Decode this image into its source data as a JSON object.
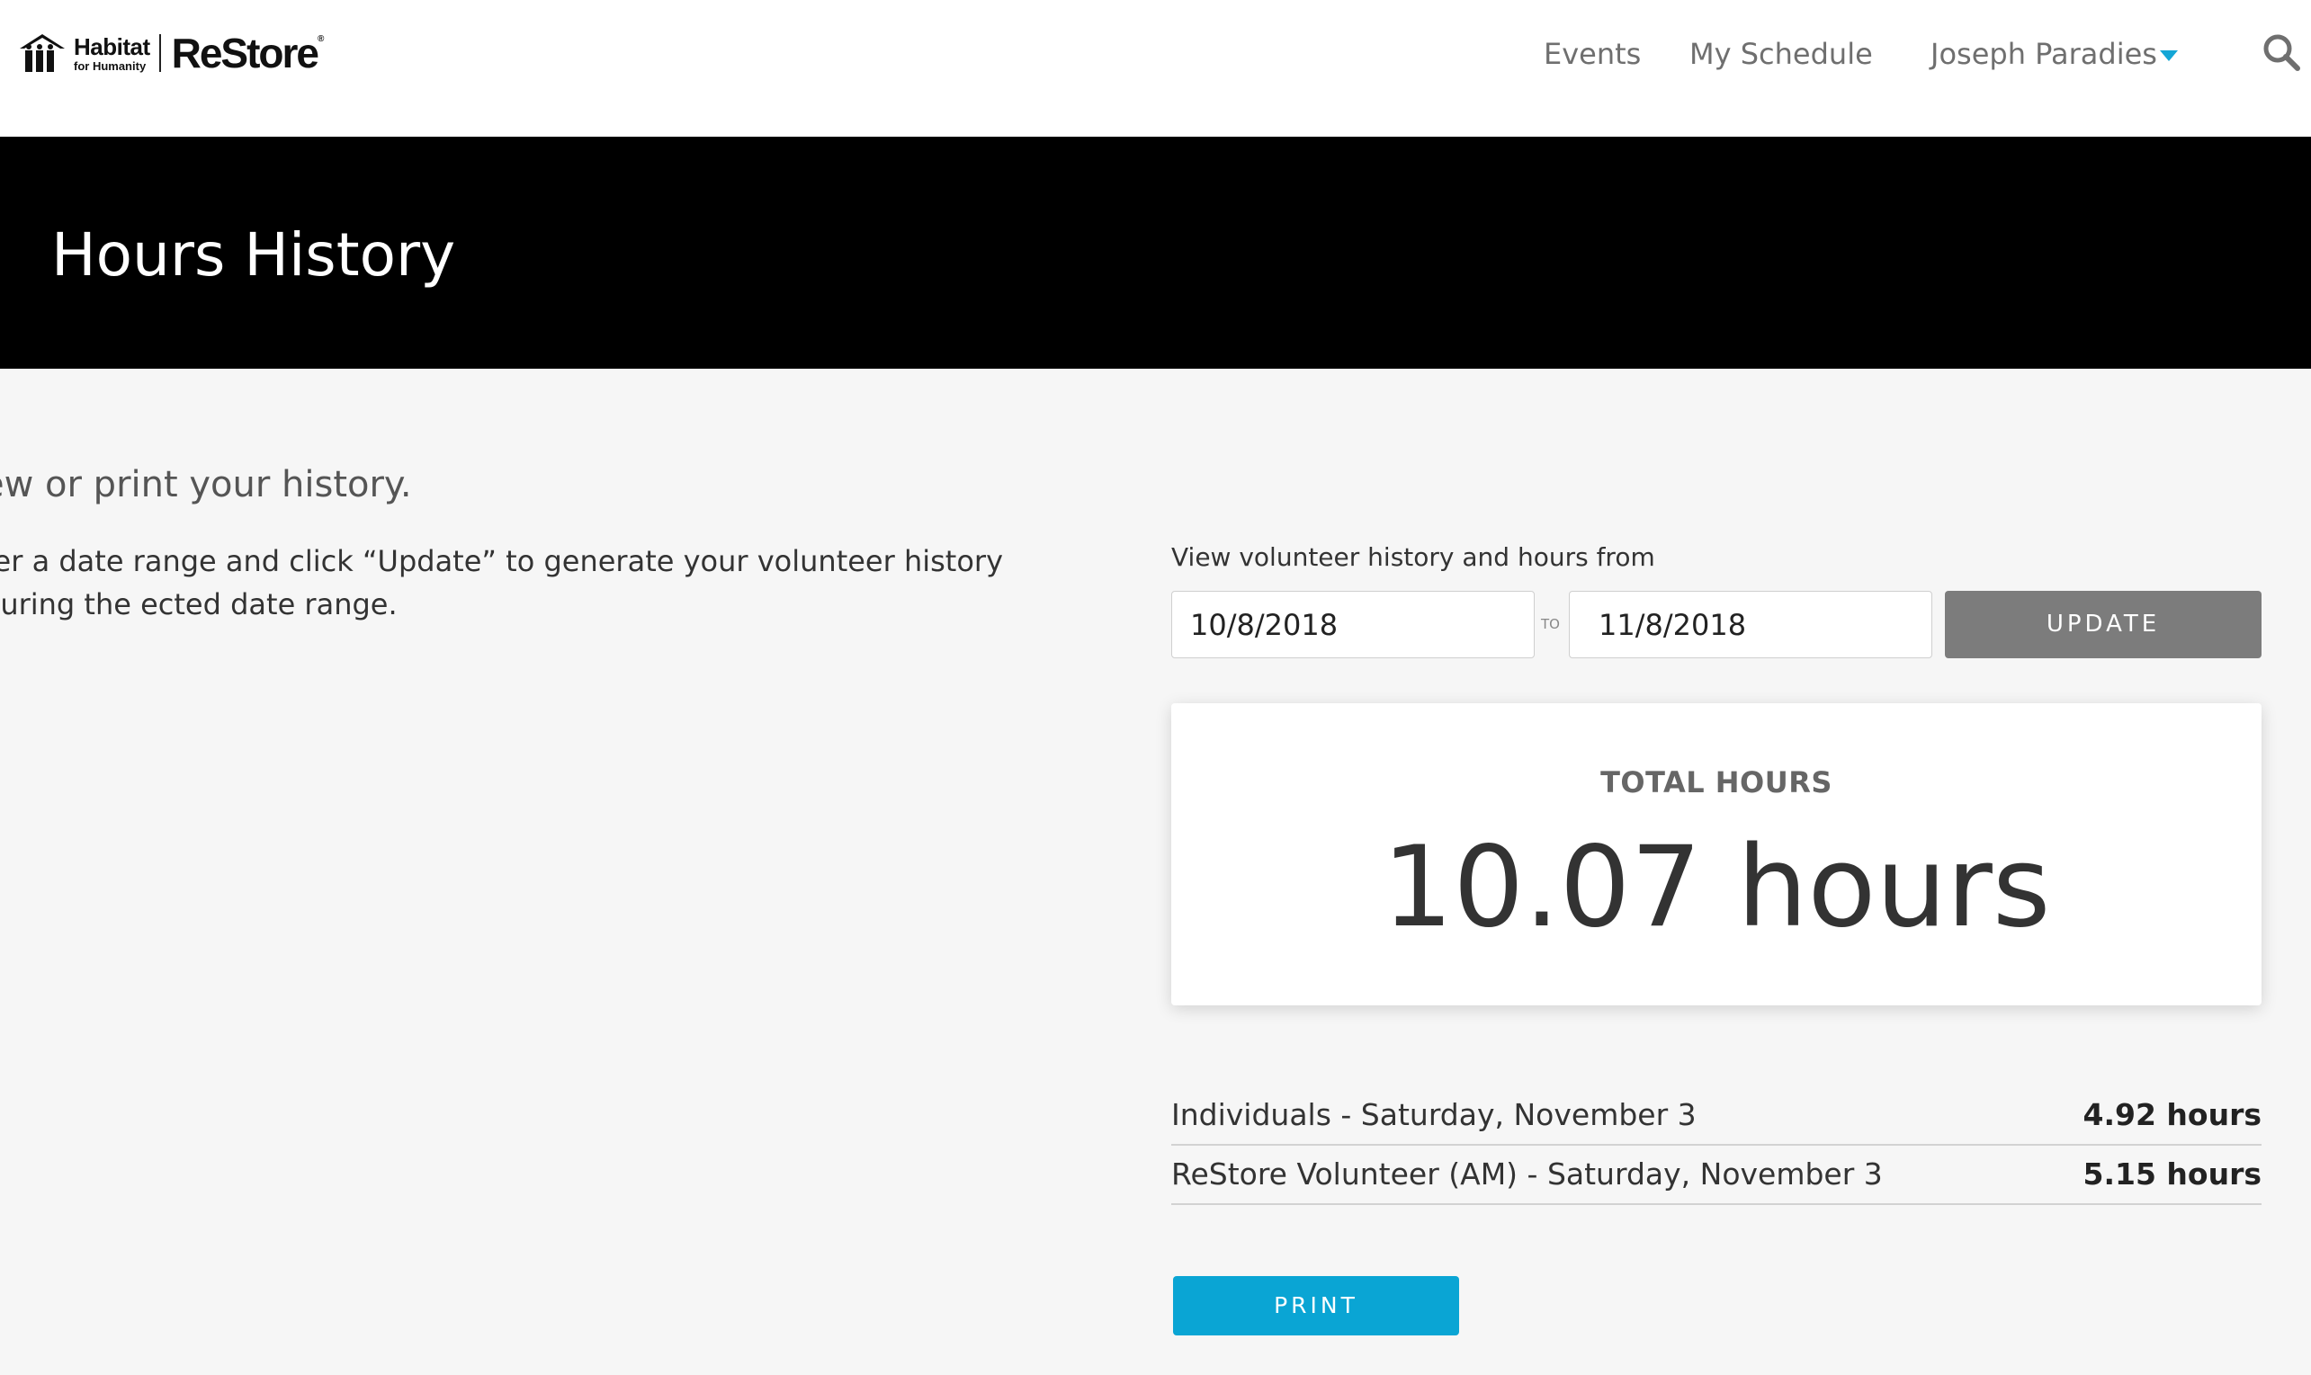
{
  "header": {
    "logo": {
      "line1": "Habitat",
      "line2": "for Humanity",
      "brand": "ReStore",
      "mark": "®"
    },
    "nav": {
      "events": "Events",
      "schedule": "My Schedule",
      "user": "Joseph Paradies"
    },
    "icons": {
      "user_menu": "chevron-down-icon",
      "search": "search-icon"
    },
    "colors": {
      "accent": "#14a6d6"
    }
  },
  "banner": {
    "title": "Hours History"
  },
  "intro": {
    "heading": "ew or print your history.",
    "body": "ter a date range and click “Update” to generate your volunteer history during the ected date range."
  },
  "range": {
    "label": "View volunteer history and hours from",
    "from": "10/8/2018",
    "to_label": "TO",
    "to": "11/8/2018",
    "update_label": "UPDATE"
  },
  "total": {
    "label": "TOTAL HOURS",
    "value": "10.07 hours"
  },
  "history": [
    {
      "name": "Individuals - Saturday, November 3",
      "hours": "4.92 hours"
    },
    {
      "name": "ReStore Volunteer (AM) - Saturday, November 3",
      "hours": "5.15 hours"
    }
  ],
  "print_label": "PRINT",
  "colors": {
    "update_button": "#7c7c7c",
    "print_button": "#0aa5d4",
    "banner": "#000000"
  }
}
